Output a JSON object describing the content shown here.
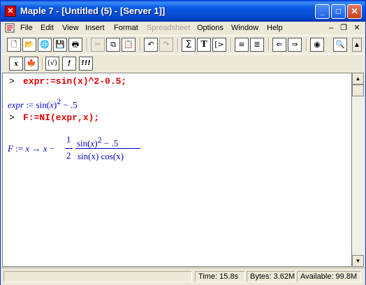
{
  "window": {
    "title": "Maple 7  - [Untitled (5) - [Server 1]]"
  },
  "title_buttons": {
    "minimize": "_",
    "maximize": "□",
    "close": "✕"
  },
  "menu": {
    "items": [
      {
        "label": "File",
        "enabled": true
      },
      {
        "label": "Edit",
        "enabled": true
      },
      {
        "label": "View",
        "enabled": true
      },
      {
        "label": "Insert",
        "enabled": true
      },
      {
        "label": "Format",
        "enabled": true
      },
      {
        "label": "Spreadsheet",
        "enabled": false
      },
      {
        "label": "Options",
        "enabled": true
      },
      {
        "label": "Window",
        "enabled": true
      },
      {
        "label": "Help",
        "enabled": true
      }
    ],
    "mdi": {
      "minimize": "–",
      "restore": "❐",
      "close": "✕"
    }
  },
  "toolbar1": {
    "new": "🗋",
    "open": "📂",
    "open_url": "🌐",
    "save": "💾",
    "print": "🖶",
    "cut": "✂",
    "copy": "⧉",
    "paste": "📋",
    "undo": "↶",
    "redo": "↷",
    "sum": "Σ",
    "text": "T",
    "insert_input": "[>",
    "indent": "≡",
    "outdent": "≣",
    "back": "⇐",
    "forward": "⇒",
    "stop": "◉",
    "zoom": "🔍"
  },
  "toolbar2": {
    "math": "x",
    "maple_leaf": "🍁",
    "check": "(√)",
    "exec": "!",
    "exec_all": "!!!"
  },
  "worksheet": {
    "prompt1": ">",
    "input1": "expr:=sin(x)^2-0.5;",
    "output1": {
      "lhs": "expr",
      "assign": ":=",
      "func": "sin",
      "arg": "x",
      "exp": "2",
      "tail": "− .5"
    },
    "prompt2": ">",
    "input2": "F:=NI(expr,x);",
    "output2": {
      "lhs": "F",
      "assign": ":=",
      "var1": "x",
      "arrow": "→",
      "var2": "x",
      "minus": "−",
      "coef_num": "1",
      "coef_den": "2",
      "num_func": "sin",
      "num_arg": "x",
      "num_exp": "2",
      "num_tail": "− .5",
      "den": "sin(x) cos(x)"
    }
  },
  "status": {
    "time": "Time:  15.8s",
    "bytes": "Bytes: 3.62M",
    "available": "Available: 99.8M"
  }
}
